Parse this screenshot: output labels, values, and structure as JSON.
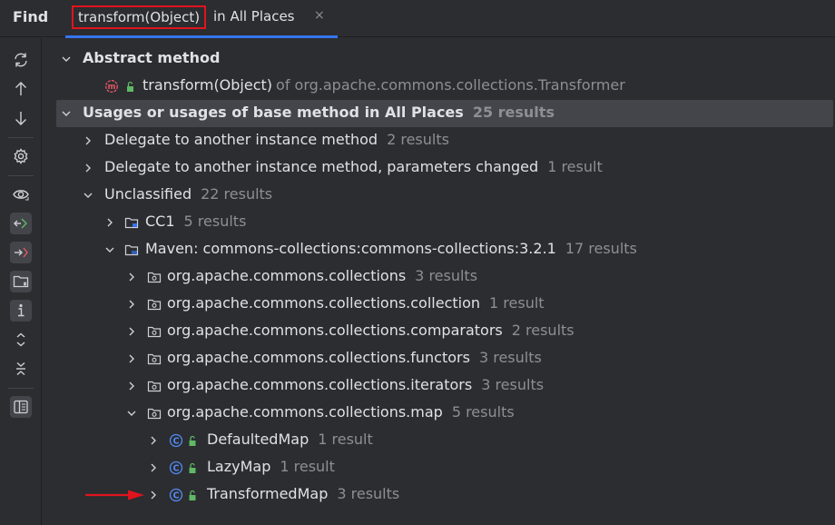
{
  "panel": {
    "title": "Find",
    "tab": {
      "query": "transform(Object)",
      "suffix": "in All Places",
      "close": "×"
    }
  },
  "toolbar": {
    "icons": [
      "rerun-icon",
      "arrow-up-icon",
      "arrow-down-icon",
      "settings-icon",
      "preview-icon",
      "navigate-with-single-click-icon",
      "autoscroll-from-source-icon",
      "group-by-directory-icon",
      "info-icon",
      "expand-all-icon",
      "collapse-all-icon",
      "layout-icon"
    ]
  },
  "tree": {
    "abstract": {
      "label": "Abstract method"
    },
    "abstract_method": {
      "name": "transform(Object)",
      "of": "of org.apache.commons.collections.Transformer"
    },
    "usages": {
      "label": "Usages or usages of base method in All Places",
      "count": "25 results"
    },
    "delegate1": {
      "label": "Delegate to another instance method",
      "count": "2 results"
    },
    "delegate2": {
      "label": "Delegate to another instance method, parameters changed",
      "count": "1 result"
    },
    "unclassified": {
      "label": "Unclassified",
      "count": "22 results"
    },
    "cc1": {
      "label": "CC1",
      "count": "5 results"
    },
    "maven": {
      "label": "Maven: commons-collections:commons-collections:3.2.1",
      "count": "17 results"
    },
    "pkg1": {
      "label": "org.apache.commons.collections",
      "count": "3 results"
    },
    "pkg2": {
      "label": "org.apache.commons.collections.collection",
      "count": "1 result"
    },
    "pkg3": {
      "label": "org.apache.commons.collections.comparators",
      "count": "2 results"
    },
    "pkg4": {
      "label": "org.apache.commons.collections.functors",
      "count": "3 results"
    },
    "pkg5": {
      "label": "org.apache.commons.collections.iterators",
      "count": "3 results"
    },
    "pkg6": {
      "label": "org.apache.commons.collections.map",
      "count": "5 results"
    },
    "cls1": {
      "label": "DefaultedMap",
      "count": "1 result"
    },
    "cls2": {
      "label": "LazyMap",
      "count": "1 result"
    },
    "cls3": {
      "label": "TransformedMap",
      "count": "3 results"
    }
  },
  "colors": {
    "accent": "#3574f0",
    "highlight_box": "#e0141e",
    "arrow": "#e0141e",
    "selection": "#43454a",
    "muted": "#8c8f94"
  }
}
